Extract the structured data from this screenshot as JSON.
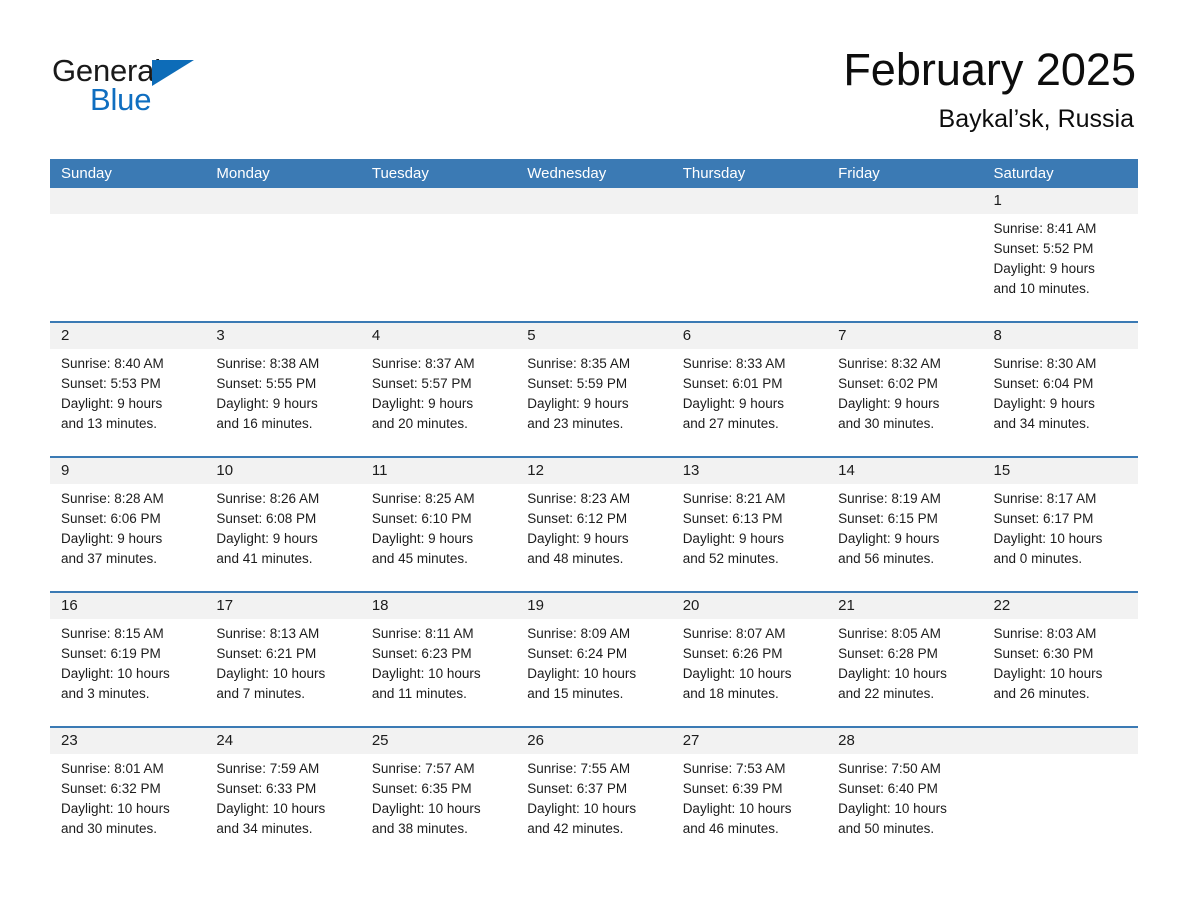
{
  "brand": {
    "word_one": "General",
    "word_two": "Blue",
    "accent_color": "#0d6cb8",
    "triangle_icon": "triangle-icon"
  },
  "header": {
    "title": "February 2025",
    "location": "Baykal’sk, Russia"
  },
  "calendar": {
    "header_color": "#3b7ab4",
    "daynum_band_color": "#f2f2f2",
    "weekdays": [
      "Sunday",
      "Monday",
      "Tuesday",
      "Wednesday",
      "Thursday",
      "Friday",
      "Saturday"
    ],
    "weeks": [
      [
        {
          "day": "",
          "lines": []
        },
        {
          "day": "",
          "lines": []
        },
        {
          "day": "",
          "lines": []
        },
        {
          "day": "",
          "lines": []
        },
        {
          "day": "",
          "lines": []
        },
        {
          "day": "",
          "lines": []
        },
        {
          "day": "1",
          "lines": [
            "Sunrise: 8:41 AM",
            "Sunset: 5:52 PM",
            "Daylight: 9 hours",
            "and 10 minutes."
          ]
        }
      ],
      [
        {
          "day": "2",
          "lines": [
            "Sunrise: 8:40 AM",
            "Sunset: 5:53 PM",
            "Daylight: 9 hours",
            "and 13 minutes."
          ]
        },
        {
          "day": "3",
          "lines": [
            "Sunrise: 8:38 AM",
            "Sunset: 5:55 PM",
            "Daylight: 9 hours",
            "and 16 minutes."
          ]
        },
        {
          "day": "4",
          "lines": [
            "Sunrise: 8:37 AM",
            "Sunset: 5:57 PM",
            "Daylight: 9 hours",
            "and 20 minutes."
          ]
        },
        {
          "day": "5",
          "lines": [
            "Sunrise: 8:35 AM",
            "Sunset: 5:59 PM",
            "Daylight: 9 hours",
            "and 23 minutes."
          ]
        },
        {
          "day": "6",
          "lines": [
            "Sunrise: 8:33 AM",
            "Sunset: 6:01 PM",
            "Daylight: 9 hours",
            "and 27 minutes."
          ]
        },
        {
          "day": "7",
          "lines": [
            "Sunrise: 8:32 AM",
            "Sunset: 6:02 PM",
            "Daylight: 9 hours",
            "and 30 minutes."
          ]
        },
        {
          "day": "8",
          "lines": [
            "Sunrise: 8:30 AM",
            "Sunset: 6:04 PM",
            "Daylight: 9 hours",
            "and 34 minutes."
          ]
        }
      ],
      [
        {
          "day": "9",
          "lines": [
            "Sunrise: 8:28 AM",
            "Sunset: 6:06 PM",
            "Daylight: 9 hours",
            "and 37 minutes."
          ]
        },
        {
          "day": "10",
          "lines": [
            "Sunrise: 8:26 AM",
            "Sunset: 6:08 PM",
            "Daylight: 9 hours",
            "and 41 minutes."
          ]
        },
        {
          "day": "11",
          "lines": [
            "Sunrise: 8:25 AM",
            "Sunset: 6:10 PM",
            "Daylight: 9 hours",
            "and 45 minutes."
          ]
        },
        {
          "day": "12",
          "lines": [
            "Sunrise: 8:23 AM",
            "Sunset: 6:12 PM",
            "Daylight: 9 hours",
            "and 48 minutes."
          ]
        },
        {
          "day": "13",
          "lines": [
            "Sunrise: 8:21 AM",
            "Sunset: 6:13 PM",
            "Daylight: 9 hours",
            "and 52 minutes."
          ]
        },
        {
          "day": "14",
          "lines": [
            "Sunrise: 8:19 AM",
            "Sunset: 6:15 PM",
            "Daylight: 9 hours",
            "and 56 minutes."
          ]
        },
        {
          "day": "15",
          "lines": [
            "Sunrise: 8:17 AM",
            "Sunset: 6:17 PM",
            "Daylight: 10 hours",
            "and 0 minutes."
          ]
        }
      ],
      [
        {
          "day": "16",
          "lines": [
            "Sunrise: 8:15 AM",
            "Sunset: 6:19 PM",
            "Daylight: 10 hours",
            "and 3 minutes."
          ]
        },
        {
          "day": "17",
          "lines": [
            "Sunrise: 8:13 AM",
            "Sunset: 6:21 PM",
            "Daylight: 10 hours",
            "and 7 minutes."
          ]
        },
        {
          "day": "18",
          "lines": [
            "Sunrise: 8:11 AM",
            "Sunset: 6:23 PM",
            "Daylight: 10 hours",
            "and 11 minutes."
          ]
        },
        {
          "day": "19",
          "lines": [
            "Sunrise: 8:09 AM",
            "Sunset: 6:24 PM",
            "Daylight: 10 hours",
            "and 15 minutes."
          ]
        },
        {
          "day": "20",
          "lines": [
            "Sunrise: 8:07 AM",
            "Sunset: 6:26 PM",
            "Daylight: 10 hours",
            "and 18 minutes."
          ]
        },
        {
          "day": "21",
          "lines": [
            "Sunrise: 8:05 AM",
            "Sunset: 6:28 PM",
            "Daylight: 10 hours",
            "and 22 minutes."
          ]
        },
        {
          "day": "22",
          "lines": [
            "Sunrise: 8:03 AM",
            "Sunset: 6:30 PM",
            "Daylight: 10 hours",
            "and 26 minutes."
          ]
        }
      ],
      [
        {
          "day": "23",
          "lines": [
            "Sunrise: 8:01 AM",
            "Sunset: 6:32 PM",
            "Daylight: 10 hours",
            "and 30 minutes."
          ]
        },
        {
          "day": "24",
          "lines": [
            "Sunrise: 7:59 AM",
            "Sunset: 6:33 PM",
            "Daylight: 10 hours",
            "and 34 minutes."
          ]
        },
        {
          "day": "25",
          "lines": [
            "Sunrise: 7:57 AM",
            "Sunset: 6:35 PM",
            "Daylight: 10 hours",
            "and 38 minutes."
          ]
        },
        {
          "day": "26",
          "lines": [
            "Sunrise: 7:55 AM",
            "Sunset: 6:37 PM",
            "Daylight: 10 hours",
            "and 42 minutes."
          ]
        },
        {
          "day": "27",
          "lines": [
            "Sunrise: 7:53 AM",
            "Sunset: 6:39 PM",
            "Daylight: 10 hours",
            "and 46 minutes."
          ]
        },
        {
          "day": "28",
          "lines": [
            "Sunrise: 7:50 AM",
            "Sunset: 6:40 PM",
            "Daylight: 10 hours",
            "and 50 minutes."
          ]
        },
        {
          "day": "",
          "lines": []
        }
      ]
    ]
  }
}
